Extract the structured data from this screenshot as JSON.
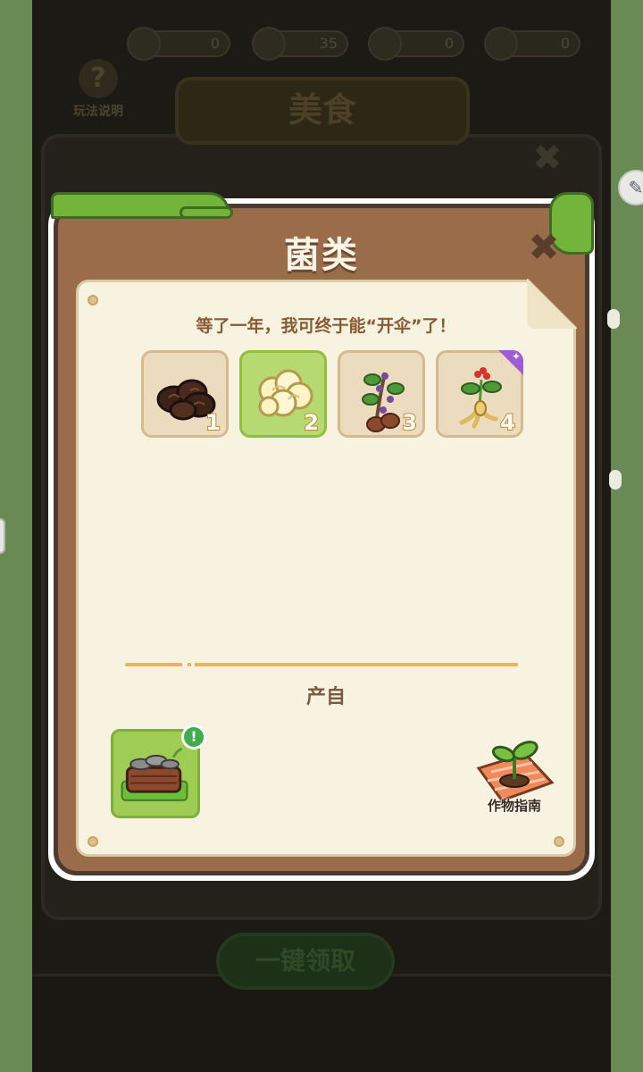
{
  "background": {
    "resources": [
      "0",
      "35",
      "0",
      "0"
    ],
    "help_label": "玩法说明",
    "screen_title": "美食",
    "claim_all_label": "一键领取"
  },
  "modal": {
    "title": "菌类",
    "quote": "等了一年，我可终于能“开伞”了！",
    "items": [
      {
        "icon": "wood-ear-mushroom-icon",
        "level": "1",
        "selected": false
      },
      {
        "icon": "white-fungus-icon",
        "level": "2",
        "selected": true
      },
      {
        "icon": "berry-root-plant-icon",
        "level": "3",
        "selected": false
      },
      {
        "icon": "ginseng-icon",
        "level": "4",
        "selected": false,
        "rare": true
      }
    ],
    "source_label": "产自",
    "source_building_icon": "mushroom-log-plot-icon",
    "guide_label": "作物指南"
  },
  "colors": {
    "frame": "#9b6c4a",
    "paper": "#f8f3e0",
    "selected_slot": "#b7d971",
    "divider": "#f0b35a"
  }
}
